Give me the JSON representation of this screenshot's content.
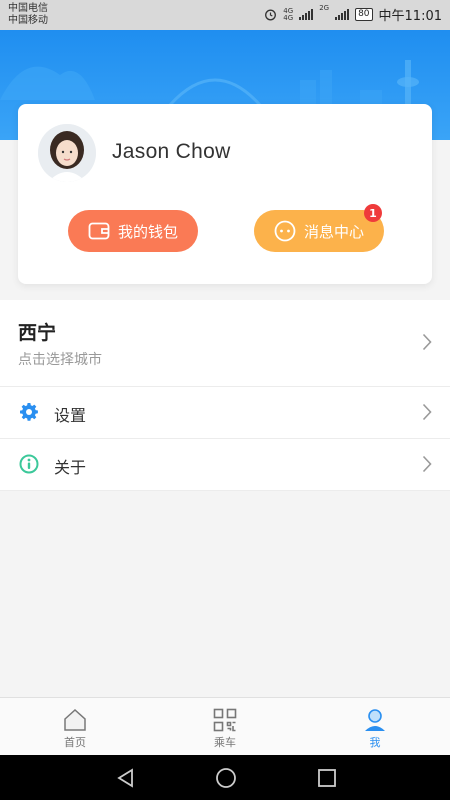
{
  "status_bar": {
    "carrier1": "中国电信",
    "carrier2": "中国移动",
    "network1": "4G",
    "network2": "2G",
    "battery": "80",
    "time": "中午11:01"
  },
  "profile": {
    "username": "Jason Chow",
    "wallet_label": "我的钱包",
    "messages_label": "消息中心",
    "messages_badge": "1"
  },
  "city": {
    "name": "西宁",
    "hint": "点击选择城市"
  },
  "menu": {
    "items": [
      {
        "label": "设置",
        "icon": "gear-icon"
      },
      {
        "label": "关于",
        "icon": "info-icon"
      }
    ]
  },
  "tabs": [
    {
      "label": "首页",
      "icon": "home-icon",
      "active": false
    },
    {
      "label": "乘车",
      "icon": "qr-code-icon",
      "active": false
    },
    {
      "label": "我",
      "icon": "user-icon",
      "active": true
    }
  ],
  "colors": {
    "header_blue": "#1f8ef0",
    "wallet_orange": "#fa7a55",
    "messages_amber": "#fcb24b",
    "badge_red": "#ef3b3b",
    "active_tab": "#2a8ff0",
    "gear_blue": "#2a8ff0",
    "info_green": "#3cc89a"
  }
}
